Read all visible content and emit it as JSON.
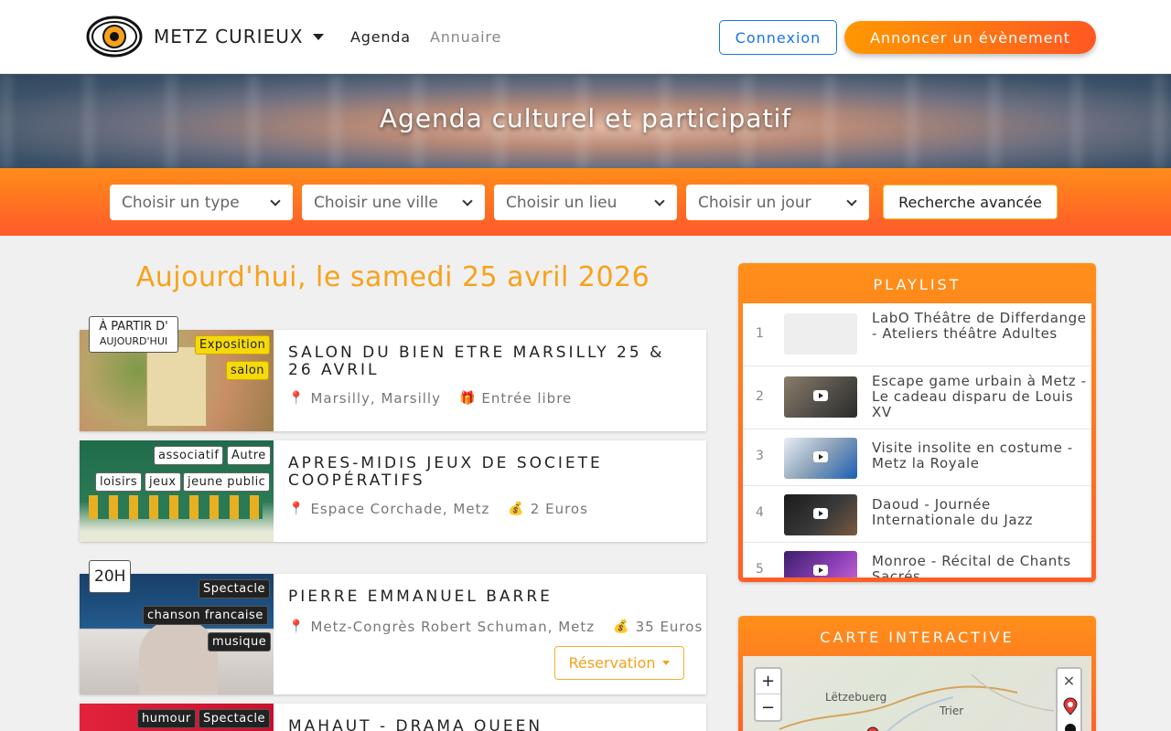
{
  "nav": {
    "brand": "METZ CURIEUX",
    "links": [
      "Agenda",
      "Annuaire"
    ],
    "login": "Connexion",
    "announce": "Annoncer un évènement"
  },
  "hero": {
    "title": "Agenda culturel et participatif"
  },
  "filters": {
    "type": "Choisir un type",
    "city": "Choisir une ville",
    "place": "Choisir un lieu",
    "day": "Choisir un jour",
    "advanced": "Recherche avancée"
  },
  "date_heading": "Aujourd'hui, le samedi 25 avril 2026",
  "events": [
    {
      "title": "SALON DU BIEN ETRE MARSILLY 25 & 26 AVRIL",
      "badge_line1": "À PARTIR D'",
      "badge_line2": "AUJOURD'HUI",
      "tags": [
        "Exposition",
        "salon"
      ],
      "location": "Marsilly, Marsilly",
      "price": "Entrée libre"
    },
    {
      "title": "APRES-MIDIS JEUX DE SOCIETE COOPÉRATIFS",
      "tags": [
        "associatif",
        "Autre",
        "loisirs",
        "jeux",
        "jeune public"
      ],
      "location": "Espace Corchade, Metz",
      "price": "2 Euros"
    },
    {
      "title": "PIERRE EMMANUEL BARRE",
      "time": "20H",
      "tags": [
        "Spectacle",
        "chanson francaise",
        "musique"
      ],
      "location": "Metz-Congrès Robert Schuman, Metz",
      "price": "35 Euros",
      "button": "Réservation"
    },
    {
      "title": "MAHAUT - DRAMA QUEEN",
      "tags": [
        "humour",
        "Spectacle"
      ]
    }
  ],
  "playlist": {
    "title": "PLAYLIST",
    "items": [
      {
        "num": "1",
        "title": "LabO Théâtre de Differdange - Ateliers théâtre Adultes"
      },
      {
        "num": "2",
        "title": "Escape game urbain à Metz - Le cadeau disparu de Louis XV"
      },
      {
        "num": "3",
        "title": "Visite insolite en costume - Metz la Royale"
      },
      {
        "num": "4",
        "title": "Daoud - Journée Internationale du Jazz"
      },
      {
        "num": "5",
        "title": "Monroe - Récital de Chants Sacrés"
      }
    ]
  },
  "map": {
    "title": "CARTE INTERACTIVE",
    "zoom_in": "+",
    "zoom_out": "−",
    "close": "✕",
    "labels": [
      "Lëtzebuerg",
      "Trier"
    ]
  }
}
